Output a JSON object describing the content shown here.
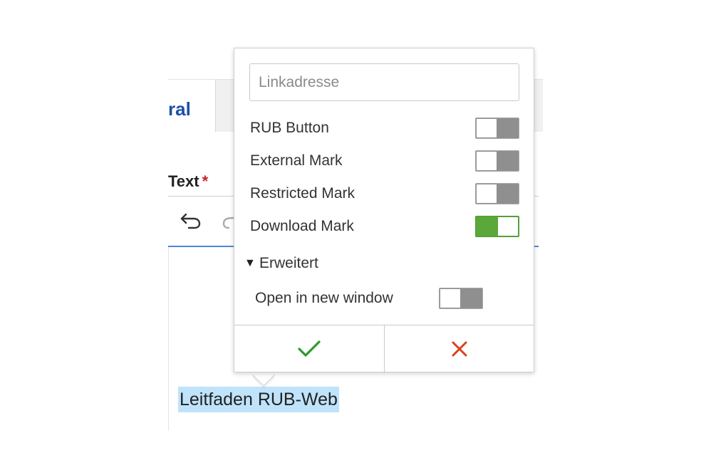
{
  "editor": {
    "tab_label": "ral",
    "field_label": "Text",
    "required_marker": "*",
    "selected_text": "Leitfaden RUB-Web"
  },
  "popup": {
    "link_input": {
      "placeholder": "Linkadresse",
      "value": ""
    },
    "options": [
      {
        "label": "RUB Button",
        "enabled": false
      },
      {
        "label": "External Mark",
        "enabled": false
      },
      {
        "label": "Restricted Mark",
        "enabled": false
      },
      {
        "label": "Download Mark",
        "enabled": true
      }
    ],
    "advanced": {
      "label": "Erweitert",
      "expanded": true,
      "open_new_window": {
        "label": "Open in new window",
        "enabled": false
      }
    },
    "confirm_icon": "check-icon",
    "cancel_icon": "close-icon"
  },
  "colors": {
    "toggle_on": "#5aa73a",
    "toggle_off": "#8f8f8f",
    "confirm": "#2e9a2e",
    "cancel": "#d9411e",
    "tab_text": "#1c4fa8",
    "selection": "#bfe3fb"
  }
}
